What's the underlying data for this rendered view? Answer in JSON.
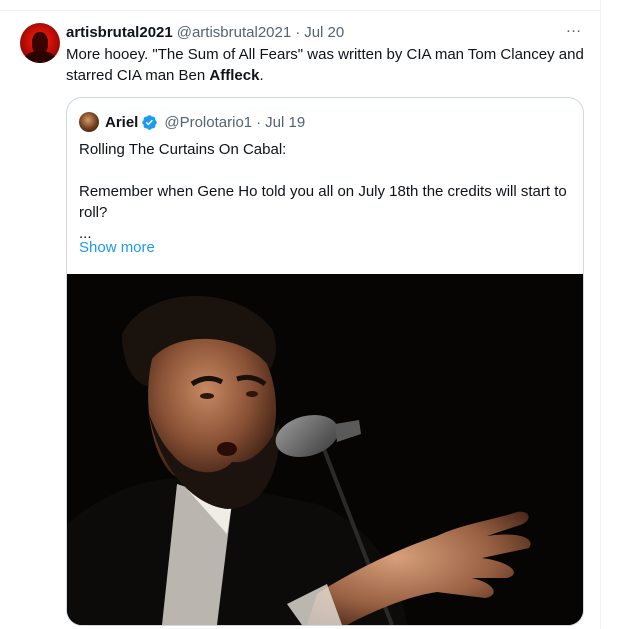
{
  "tweet": {
    "display_name": "artisbrutal2021",
    "handle": "@artisbrutal2021",
    "separator": "·",
    "date": "Jul 20",
    "more_icon": "…",
    "text_before": "More hooey. \"The Sum of All Fears\" was written by CIA man Tom Clancey and starred CIA man Ben ",
    "text_bold": "Affleck",
    "text_after": "."
  },
  "quoted_tweet": {
    "display_name": "Ariel",
    "handle": "@Prolotario1",
    "separator": "·",
    "date": "Jul 19",
    "line1": "Rolling The Curtains On Cabal:",
    "line2": "Remember when Gene Ho told you all on July 18th the credits will start to roll?",
    "line3": "...",
    "show_more": "Show more",
    "verified_color": "#1d9bf0",
    "media_alt": "Bearded tenor in tuxedo singing into a microphone with outstretched hand on dark stage"
  }
}
